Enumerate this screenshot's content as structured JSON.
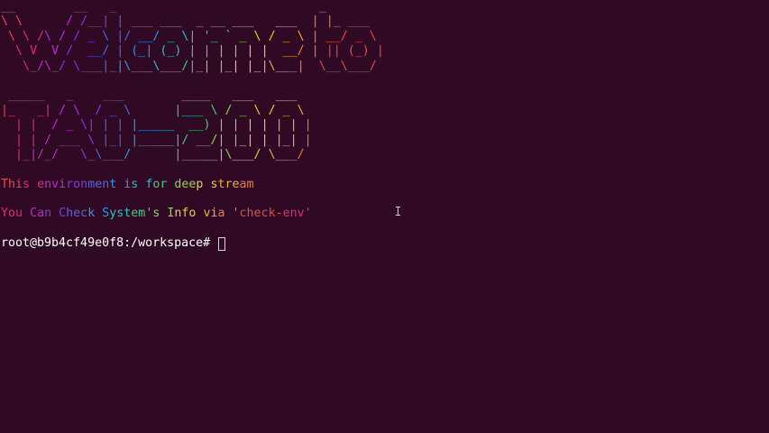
{
  "banner": {
    "welcome_rows": [
      "__        __   _                            _",
      "\\ \\      / /__| | ___ ___  _ __ ___   ___  | |_ ___",
      " \\ \\ /\\ / / _ \\ |/ __/ _ \\| '_ ` _ \\ / _ \\ | __/ _ \\",
      "  \\ V  V /  __/ | (_| (_) | | | | | |  __/ | || (_) |",
      "   \\_/\\_/ \\___|_|\\___\\___/|_| |_| |_|\\___|  \\__\\___/"
    ],
    "tao_rows": [
      " _____   _    ___        ____   ___   ___",
      "|_   _| / \\  / _ \\      |___ \\ / _ \\ / _ \\",
      "  | |  / _ \\| | | |_____  __) | | | | | | |",
      "  | | / ___ \\ |_| |_____|/ __/| |_| | |_| |",
      "  |_|/_/   \\_\\___/      |_____|\\___/ \\___/"
    ]
  },
  "messages": {
    "environment_line": "This environment is for deep stream",
    "check_line_prefix": "You Can Check System's Info via ",
    "check_command": "'check-env'"
  },
  "prompt": {
    "text": "root@b9b4cf49e0f8:/workspace# "
  },
  "colors": {
    "background": "#300a24",
    "foreground": "#ffffff",
    "rainbow": [
      "#e8484e",
      "#e22b79",
      "#c02ad0",
      "#7a3cf0",
      "#4d66f0",
      "#2a9bf0",
      "#25c2c8",
      "#3ccf7a",
      "#88d848",
      "#d8d830",
      "#f0b030",
      "#f07a30",
      "#e84848"
    ]
  }
}
